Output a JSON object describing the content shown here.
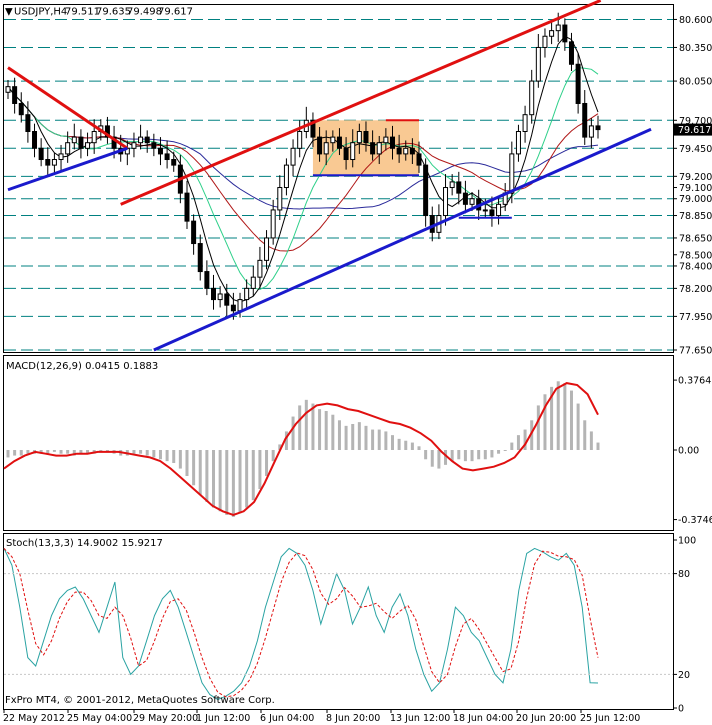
{
  "window": {
    "symbol_header": "USDJPY,H4",
    "ohlc": [
      "79.511",
      "79.635",
      "79.498",
      "79.617"
    ],
    "watermark": "FxPro MT4, © 2001-2012, MetaQuotes Software Corp."
  },
  "colors": {
    "background": "#ffffff",
    "candle": "#000000",
    "grid_dash": "#008080",
    "trend_red": "#e01010",
    "trend_blue": "#1a1acc",
    "range_box": "#f9c993",
    "ma_blue": "#2a2a9a",
    "ma_red": "#b01818",
    "ma_green": "#2fd08a",
    "ma_black": "#000000",
    "macd_hist": "#b4b4b4",
    "macd_signal": "#e01010",
    "stoch_main": "#2aa3a3",
    "stoch_signal": "#e01010",
    "price_tag_bg": "#000000",
    "price_tag_text": "#ffffff"
  },
  "chart_data": [
    {
      "type": "candlestick",
      "panel": "price",
      "symbol": "USDJPY",
      "timeframe": "H4",
      "x_labels": [
        "22 May 2012",
        "25 May 04:00",
        "29 May 20:00",
        "1 Jun 12:00",
        "6 Jun 04:00",
        "8 Jun 20:00",
        "13 Jun 12:00",
        "18 Jun 04:00",
        "20 Jun 20:00",
        "25 Jun 12:00"
      ],
      "y_ticks": [
        "80.600",
        "80.350",
        "80.050",
        "79.700",
        "79.450",
        "79.200",
        "79.100",
        "79.000",
        "78.850",
        "78.650",
        "78.500",
        "78.400",
        "78.200",
        "77.950",
        "77.650"
      ],
      "dashed_levels": [
        80.6,
        80.35,
        80.05,
        79.7,
        79.45,
        79.2,
        79.0,
        78.85,
        78.65,
        78.4,
        78.2,
        77.95,
        77.65
      ],
      "ylim": [
        77.65,
        80.72
      ],
      "last_price": "79.617",
      "close": [
        80.0,
        79.85,
        79.75,
        79.6,
        79.45,
        79.35,
        79.3,
        79.35,
        79.4,
        79.5,
        79.55,
        79.45,
        79.5,
        79.6,
        79.65,
        79.55,
        79.45,
        79.4,
        79.45,
        79.5,
        79.55,
        79.5,
        79.45,
        79.4,
        79.35,
        79.3,
        79.05,
        78.8,
        78.6,
        78.35,
        78.2,
        78.1,
        78.15,
        78.05,
        78.0,
        78.1,
        78.2,
        78.3,
        78.45,
        78.65,
        78.9,
        79.1,
        79.3,
        79.45,
        79.6,
        79.7,
        79.55,
        79.4,
        79.5,
        79.55,
        79.45,
        79.35,
        79.5,
        79.6,
        79.5,
        79.4,
        79.5,
        79.55,
        79.45,
        79.4,
        79.45,
        79.4,
        79.3,
        78.85,
        78.7,
        78.85,
        79.1,
        79.15,
        79.05,
        78.95,
        79.0,
        78.9,
        78.9,
        78.85,
        78.95,
        79.05,
        79.4,
        79.6,
        79.75,
        80.05,
        80.35,
        80.45,
        80.5,
        80.55,
        80.4,
        80.2,
        79.85,
        79.55,
        79.65,
        79.617
      ],
      "overlays": {
        "moving_averages": [
          "blue",
          "red",
          "green",
          "black"
        ],
        "red_trendlines": 2,
        "blue_trendlines": 3,
        "range_box": {
          "top": 79.7,
          "bottom": 79.2
        }
      }
    },
    {
      "type": "bar",
      "panel": "macd",
      "title": "MACD(12,26,9) 0.0415 0.1883",
      "y_ticks": [
        "0.3764",
        "0.00",
        "-0.3746"
      ],
      "ylim": [
        -0.42,
        0.42
      ],
      "histogram": [
        -0.04,
        -0.03,
        -0.03,
        -0.02,
        -0.02,
        -0.02,
        -0.02,
        -0.01,
        -0.02,
        -0.02,
        -0.03,
        -0.02,
        -0.02,
        -0.02,
        -0.01,
        -0.01,
        -0.02,
        -0.03,
        -0.03,
        -0.02,
        -0.02,
        -0.03,
        -0.04,
        -0.05,
        -0.06,
        -0.07,
        -0.1,
        -0.14,
        -0.19,
        -0.24,
        -0.28,
        -0.31,
        -0.33,
        -0.35,
        -0.36,
        -0.34,
        -0.31,
        -0.27,
        -0.21,
        -0.14,
        -0.06,
        0.03,
        0.1,
        0.18,
        0.24,
        0.27,
        0.25,
        0.22,
        0.21,
        0.19,
        0.16,
        0.13,
        0.14,
        0.15,
        0.13,
        0.11,
        0.11,
        0.1,
        0.08,
        0.06,
        0.05,
        0.04,
        0.02,
        -0.05,
        -0.09,
        -0.1,
        -0.08,
        -0.06,
        -0.05,
        -0.06,
        -0.06,
        -0.05,
        -0.05,
        -0.04,
        -0.02,
        0.0,
        0.04,
        0.08,
        0.11,
        0.16,
        0.24,
        0.3,
        0.34,
        0.37,
        0.36,
        0.32,
        0.25,
        0.16,
        0.1,
        0.04
      ],
      "signal": [
        -0.1,
        -0.06,
        -0.03,
        -0.01,
        -0.02,
        -0.03,
        -0.03,
        -0.02,
        -0.02,
        -0.01,
        -0.01,
        -0.01,
        -0.02,
        -0.03,
        -0.04,
        -0.06,
        -0.1,
        -0.15,
        -0.2,
        -0.25,
        -0.3,
        -0.33,
        -0.35,
        -0.33,
        -0.28,
        -0.18,
        -0.06,
        0.06,
        0.14,
        0.2,
        0.24,
        0.25,
        0.24,
        0.22,
        0.21,
        0.19,
        0.17,
        0.15,
        0.14,
        0.12,
        0.09,
        0.05,
        -0.01,
        -0.06,
        -0.1,
        -0.11,
        -0.1,
        -0.09,
        -0.07,
        -0.04,
        0.03,
        0.13,
        0.24,
        0.33,
        0.36,
        0.35,
        0.3,
        0.19
      ]
    },
    {
      "type": "line",
      "panel": "stochastic",
      "title": "Stoch(13,3,3) 14.9002 15.9217",
      "y_ticks": [
        "100",
        "80",
        "20",
        "0"
      ],
      "ylim": [
        0,
        100
      ],
      "main": [
        95,
        85,
        60,
        30,
        25,
        40,
        55,
        65,
        70,
        72,
        65,
        55,
        45,
        60,
        75,
        30,
        20,
        25,
        40,
        55,
        65,
        70,
        60,
        45,
        30,
        15,
        8,
        5,
        7,
        10,
        15,
        25,
        40,
        60,
        75,
        90,
        95,
        92,
        85,
        70,
        50,
        65,
        80,
        70,
        50,
        60,
        72,
        55,
        45,
        60,
        68,
        55,
        35,
        20,
        10,
        15,
        35,
        60,
        55,
        45,
        40,
        30,
        20,
        15,
        35,
        70,
        92,
        95,
        93,
        90,
        88,
        92,
        85,
        60,
        15,
        14.9
      ]
    }
  ]
}
